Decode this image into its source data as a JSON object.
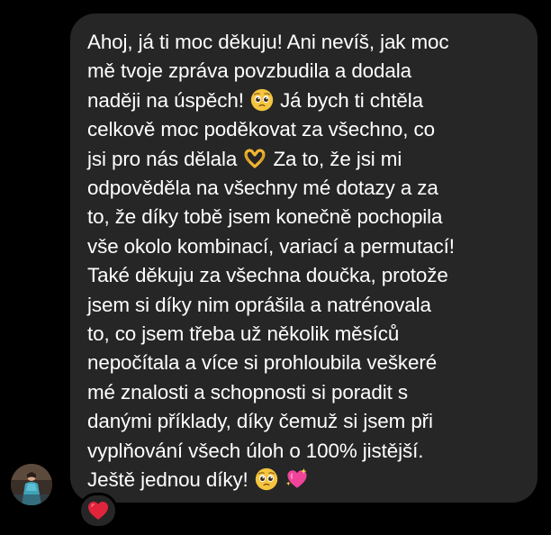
{
  "message": {
    "lines": [
      "Ahoj, já ti moc děkuju! Ani nevíš, jak moc",
      "mě tvoje zpráva povzbudila a dodala",
      "naději na úspěch!",
      " Já bych ti chtěla",
      "celkově moc poděkovat za všechno, co",
      "jsi pro nás dělala",
      " Za to, že jsi mi",
      "odpověděla na všechny mé dotazy a za",
      "to, že díky tobě jsem konečně pochopila",
      "vše okolo kombinací, variací a permutací!",
      "Také děkuju za všechna doučka, protože",
      "jsem si díky nim oprášila a natrénovala",
      "to, co jsem třeba už několik měsíců",
      "nepočítala a více si prohloubila veškeré",
      "mé znalosti a schopnosti si poradit s",
      "danými příklady, díky čemuž si jsem při",
      "vyplňování všech úloh o 100% jistější.",
      "Ještě jednou díky!"
    ],
    "emojis": [
      "pleading-face-emoji",
      "heart-hands-emoji",
      "pleading-face-emoji",
      "sparkling-heart-emoji"
    ]
  },
  "reaction": {
    "emoji": "red-heart-emoji",
    "color": "#e0243b"
  },
  "colors": {
    "background": "#000000",
    "bubble": "#262626",
    "text": "#ffffff"
  }
}
